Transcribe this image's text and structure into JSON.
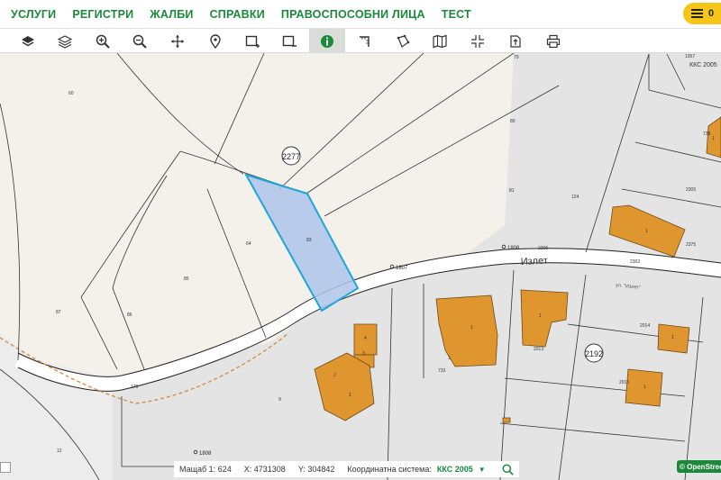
{
  "nav": {
    "items": [
      "УСЛУГИ",
      "РЕГИСТРИ",
      "ЖАЛБИ",
      "СПРАВКИ",
      "ПРАВОСПОСОБНИ ЛИЦА",
      "ТЕСТ"
    ],
    "menu_label": "0"
  },
  "toolbar": {
    "tools": [
      "layers-icon",
      "layers-stack-icon",
      "zoom-in-icon",
      "zoom-out-icon",
      "pan-icon",
      "location-pin-icon",
      "select-rectangle-icon",
      "deselect-rectangle-icon",
      "info-icon",
      "measure-distance-icon",
      "measure-area-icon",
      "map-icon",
      "crosshair-icon",
      "export-icon",
      "print-icon"
    ],
    "active_tool": "info-icon"
  },
  "map": {
    "street_name": "Излет",
    "street_label": "ул. \"Излет\"",
    "parcel_labels": [
      "60",
      "79",
      "80",
      "81",
      "124",
      "64",
      "83",
      "85",
      "86",
      "87",
      "176",
      "12",
      "9",
      "733",
      "738",
      "2013",
      "2014",
      "2015",
      "2302",
      "2305",
      "2306",
      "2375",
      "1957",
      "4",
      "3",
      "2",
      "1",
      "1",
      "1",
      "1",
      "1",
      "1",
      "1",
      "1"
    ],
    "circled_numbers": [
      "2277",
      "2192"
    ],
    "points": [
      "1806",
      "1807",
      "1808"
    ],
    "corner_label": "ККС 2005",
    "selected_parcel": "83",
    "selected_fill": "#aec4ea",
    "selected_stroke": "#1ea6d8",
    "building_color": "#e0962e"
  },
  "status": {
    "scale_label": "Мащаб 1:",
    "scale_value": "624",
    "x_label": "X:",
    "x_value": "4731308",
    "y_label": "Y:",
    "y_value": "304842",
    "crs_label": "Координатна система:",
    "crs_value": "ККС 2005",
    "search_icon": "search-icon"
  },
  "attribution": "© OpenStreetMap"
}
